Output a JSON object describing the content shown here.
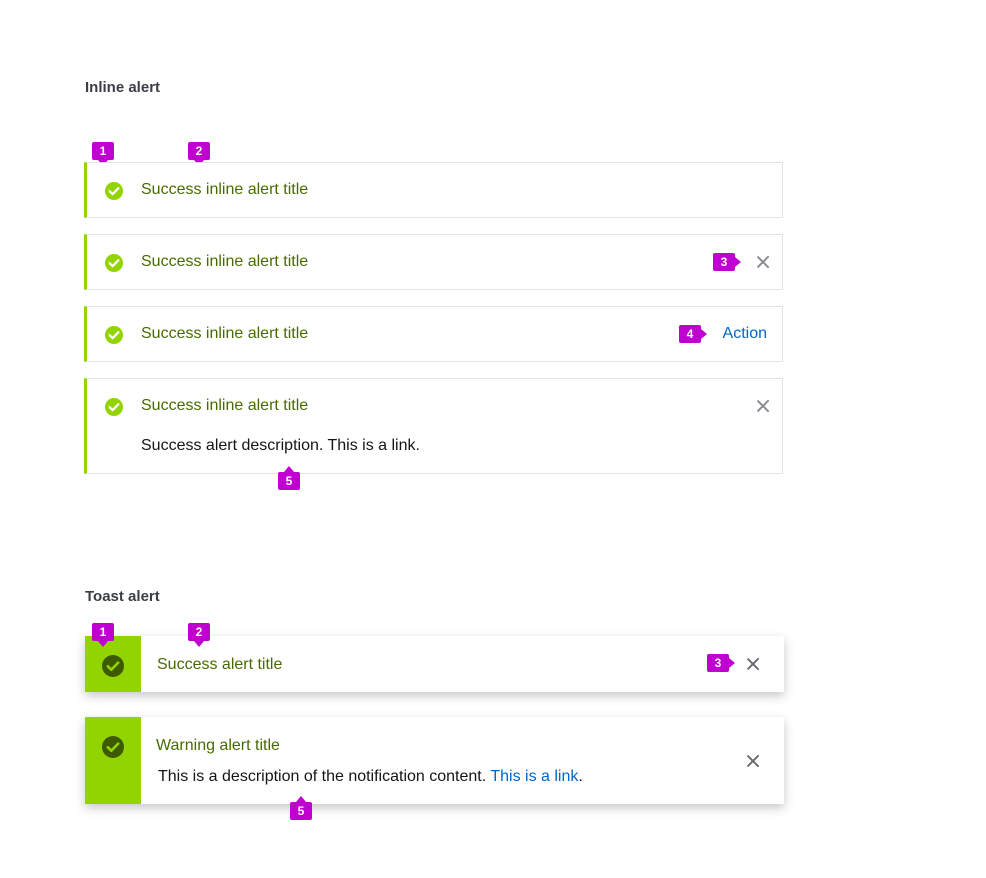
{
  "colors": {
    "success_accent": "#92d400",
    "success_text": "#486b00",
    "link": "#0066cc",
    "callout": "#c000d0",
    "close_icon": "#8a8d90"
  },
  "inline_section": {
    "heading": "Inline alert",
    "alerts": [
      {
        "icon": "check-circle-icon",
        "title": "Success inline alert title"
      },
      {
        "icon": "check-circle-icon",
        "title": "Success inline alert title",
        "close_icon": "close-icon"
      },
      {
        "icon": "check-circle-icon",
        "title": "Success inline alert title",
        "action_label": "Action"
      },
      {
        "icon": "check-circle-icon",
        "title": "Success inline alert title",
        "description": "Success alert description. This is a link.",
        "close_icon": "close-icon"
      }
    ]
  },
  "toast_section": {
    "heading": "Toast alert",
    "alerts": [
      {
        "icon": "check-circle-icon",
        "title": "Success alert title",
        "close_icon": "close-icon"
      },
      {
        "icon": "check-circle-icon",
        "title": "Warning alert title",
        "description": "This is a description of the notification content.",
        "link_text": "This is a link",
        "link_suffix": ".",
        "close_icon": "close-icon"
      }
    ]
  },
  "callouts": {
    "n1": "1",
    "n2": "2",
    "n3": "3",
    "n4": "4",
    "n5": "5"
  }
}
